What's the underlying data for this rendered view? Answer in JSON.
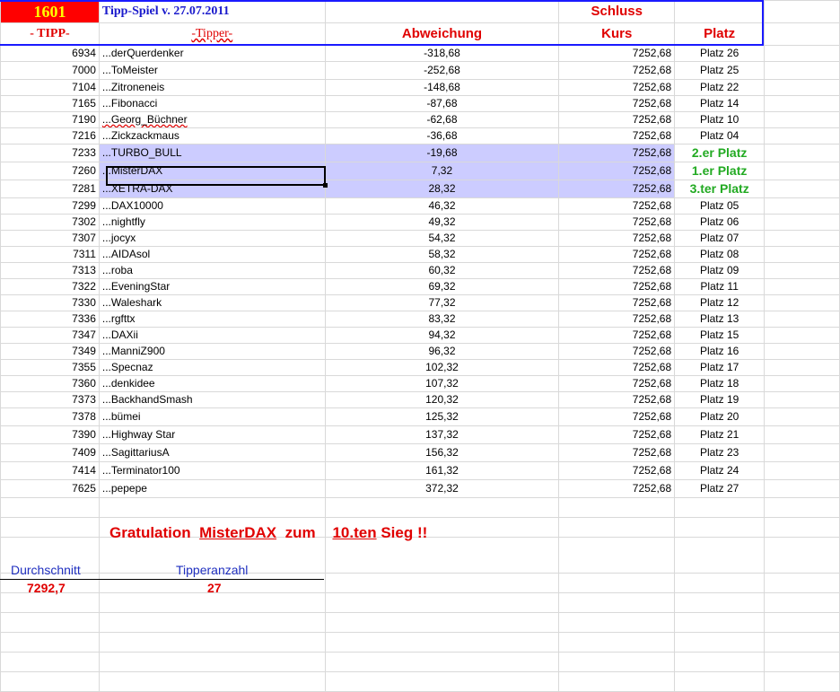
{
  "header": {
    "tipp_number": "1601",
    "title": "Tipp-Spiel v. 27.07.2011",
    "schluss": "Schluss",
    "col_tipp": "- TIPP-",
    "col_tipper": "-Tipper-",
    "col_abweichung": "Abweichung",
    "col_kurs": "Kurs",
    "col_platz": "Platz"
  },
  "rows": [
    {
      "tipp": "6934",
      "name": "...derQuerdenker",
      "abw": "-318,68",
      "kurs": "7252,68",
      "platz": "Platz 26"
    },
    {
      "tipp": "7000",
      "name": "...ToMeister",
      "abw": "-252,68",
      "kurs": "7252,68",
      "platz": "Platz 25"
    },
    {
      "tipp": "7104",
      "name": "...Zitroneneis",
      "abw": "-148,68",
      "kurs": "7252,68",
      "platz": "Platz 22"
    },
    {
      "tipp": "7165",
      "name": "...Fibonacci",
      "abw": "-87,68",
      "kurs": "7252,68",
      "platz": "Platz 14"
    },
    {
      "tipp": "7190",
      "name": "...Georg_Büchner",
      "abw": "-62,68",
      "kurs": "7252,68",
      "platz": "Platz 10"
    },
    {
      "tipp": "7216",
      "name": "...Zickzackmaus",
      "abw": "-36,68",
      "kurs": "7252,68",
      "platz": "Platz 04"
    },
    {
      "tipp": "7233",
      "name": "...TURBO_BULL",
      "abw": "-19,68",
      "kurs": "7252,68",
      "platz": "2.er Platz",
      "highlight": true
    },
    {
      "tipp": "7260",
      "name": "...MisterDAX",
      "abw": "7,32",
      "kurs": "7252,68",
      "platz": "1.er Platz",
      "highlight": true
    },
    {
      "tipp": "7281",
      "name": "...XETRA-DAX",
      "abw": "28,32",
      "kurs": "7252,68",
      "platz": "3.ter Platz",
      "highlight": true
    },
    {
      "tipp": "7299",
      "name": "...DAX10000",
      "abw": "46,32",
      "kurs": "7252,68",
      "platz": "Platz 05"
    },
    {
      "tipp": "7302",
      "name": "...nightfly",
      "abw": "49,32",
      "kurs": "7252,68",
      "platz": "Platz 06"
    },
    {
      "tipp": "7307",
      "name": "...jocyx",
      "abw": "54,32",
      "kurs": "7252,68",
      "platz": "Platz 07"
    },
    {
      "tipp": "7311",
      "name": "...AIDAsol",
      "abw": "58,32",
      "kurs": "7252,68",
      "platz": "Platz 08"
    },
    {
      "tipp": "7313",
      "name": "...roba",
      "abw": "60,32",
      "kurs": "7252,68",
      "platz": "Platz 09"
    },
    {
      "tipp": "7322",
      "name": "...EveningStar",
      "abw": "69,32",
      "kurs": "7252,68",
      "platz": "Platz 11"
    },
    {
      "tipp": "7330",
      "name": "...Waleshark",
      "abw": "77,32",
      "kurs": "7252,68",
      "platz": "Platz 12"
    },
    {
      "tipp": "7336",
      "name": "...rgfttx",
      "abw": "83,32",
      "kurs": "7252,68",
      "platz": "Platz 13"
    },
    {
      "tipp": "7347",
      "name": "...DAXii",
      "abw": "94,32",
      "kurs": "7252,68",
      "platz": "Platz 15"
    },
    {
      "tipp": "7349",
      "name": "...ManniZ900",
      "abw": "96,32",
      "kurs": "7252,68",
      "platz": "Platz 16"
    },
    {
      "tipp": "7355",
      "name": "...Specnaz",
      "abw": "102,32",
      "kurs": "7252,68",
      "platz": "Platz 17"
    },
    {
      "tipp": "7360",
      "name": "...denkidee",
      "abw": "107,32",
      "kurs": "7252,68",
      "platz": "Platz 18"
    },
    {
      "tipp": "7373",
      "name": "...BackhandSmash",
      "abw": "120,32",
      "kurs": "7252,68",
      "platz": "Platz 19"
    },
    {
      "tipp": "7378",
      "name": "...bümei",
      "abw": "125,32",
      "kurs": "7252,68",
      "platz": "Platz 20"
    },
    {
      "tipp": "7390",
      "name": "...Highway Star",
      "abw": "137,32",
      "kurs": "7252,68",
      "platz": "Platz 21"
    },
    {
      "tipp": "7409",
      "name": "...SagittariusA",
      "abw": "156,32",
      "kurs": "7252,68",
      "platz": "Platz 23"
    },
    {
      "tipp": "7414",
      "name": "...Terminator100",
      "abw": "161,32",
      "kurs": "7252,68",
      "platz": "Platz 24"
    },
    {
      "tipp": "7625",
      "name": "...pepepe",
      "abw": "372,32",
      "kurs": "7252,68",
      "platz": "Platz 27"
    }
  ],
  "gratulation": {
    "prefix": "Gratulation ",
    "name": "MisterDAX",
    "middle": " zum ",
    "count": "10.ten",
    "suffix": " Sieg !!"
  },
  "stats": {
    "durchschnitt_label": "Durchschnitt",
    "durchschnitt_value": "7292,7",
    "tipperanzahl_label": "Tipperanzahl",
    "tipperanzahl_value": "27"
  },
  "colors": {
    "header_border": "#1a1aff",
    "highlight": "#ccccff",
    "podium_text": "#22aa22",
    "accent_red": "#e00000"
  }
}
